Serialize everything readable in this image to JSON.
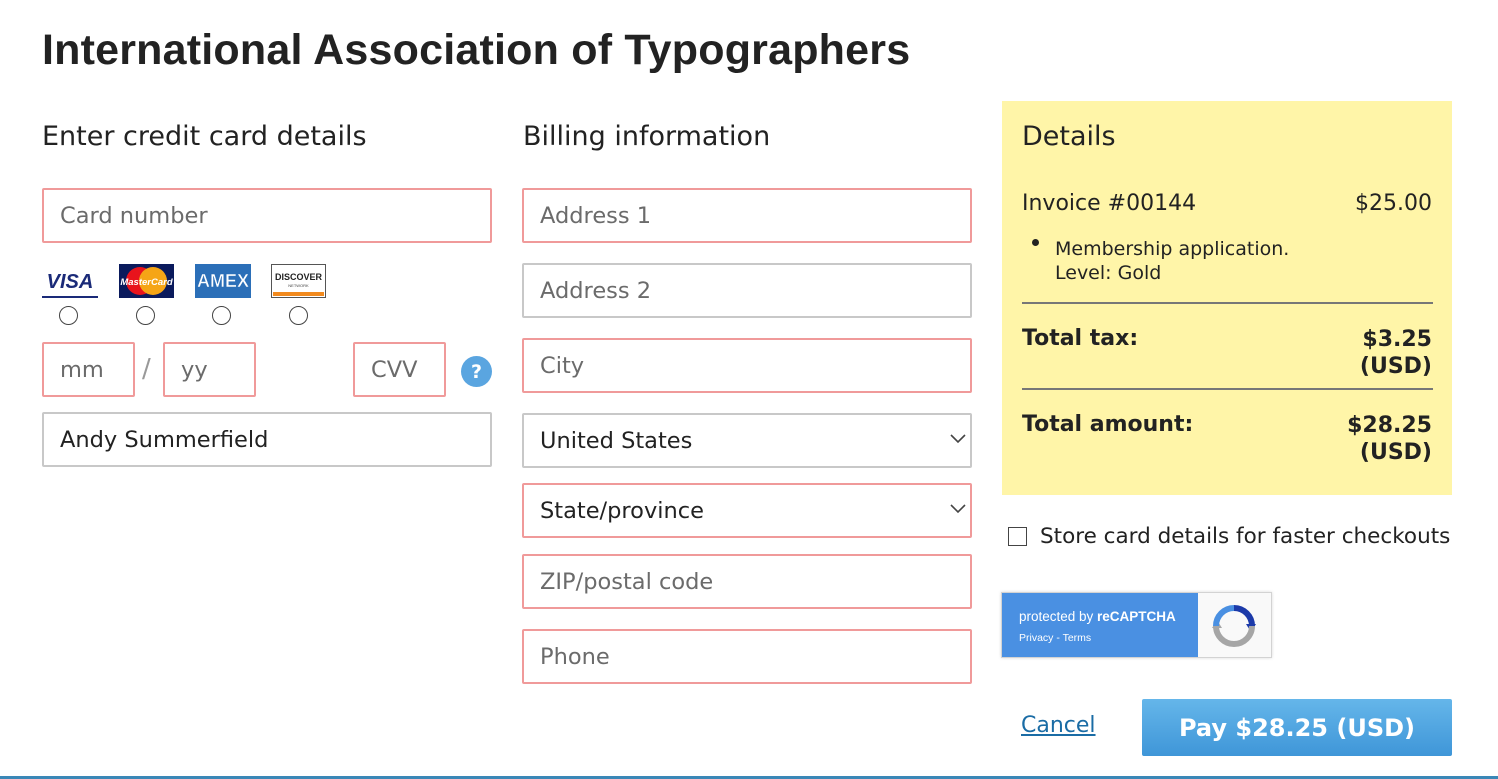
{
  "page": {
    "title": "International Association of Typographers"
  },
  "card_section": {
    "heading": "Enter credit card details",
    "card_number_placeholder": "Card number",
    "card_types": [
      {
        "name": "VISA",
        "icon": "visa-logo"
      },
      {
        "name": "MasterCard",
        "icon": "mastercard-logo"
      },
      {
        "name": "AMEX",
        "icon": "amex-logo"
      },
      {
        "name": "DISCOVER",
        "icon": "discover-logo"
      }
    ],
    "month_placeholder": "mm",
    "separator": "/",
    "year_placeholder": "yy",
    "cvv_placeholder": "CVV",
    "help_label": "?",
    "cardholder_name": "Andy Summerfield"
  },
  "billing_section": {
    "heading": "Billing information",
    "address1_placeholder": "Address 1",
    "address2_placeholder": "Address 2",
    "city_placeholder": "City",
    "country_value": "United States",
    "state_value": "State/province",
    "zip_placeholder": "ZIP/postal code",
    "phone_placeholder": "Phone"
  },
  "details": {
    "heading": "Details",
    "invoice_label": "Invoice #00144",
    "invoice_amount": "$25.00",
    "item_description": "Membership application. Level: Gold",
    "tax_label": "Total tax:",
    "tax_value_line1": "$3.25",
    "tax_value_line2": "(USD)",
    "total_label": "Total amount:",
    "total_value_line1": "$28.25",
    "total_value_line2": "(USD)",
    "background_color": "#fff5a8"
  },
  "store_card": {
    "label": "Store card details for faster checkouts",
    "checked": false
  },
  "recaptcha": {
    "line1_prefix": "protected by ",
    "line1_brand": "reCAPTCHA",
    "privacy": "Privacy",
    "separator": " - ",
    "terms": "Terms"
  },
  "actions": {
    "cancel_label": "Cancel",
    "pay_label": "Pay $28.25 (USD)",
    "accent_color": "#3f96d8"
  }
}
